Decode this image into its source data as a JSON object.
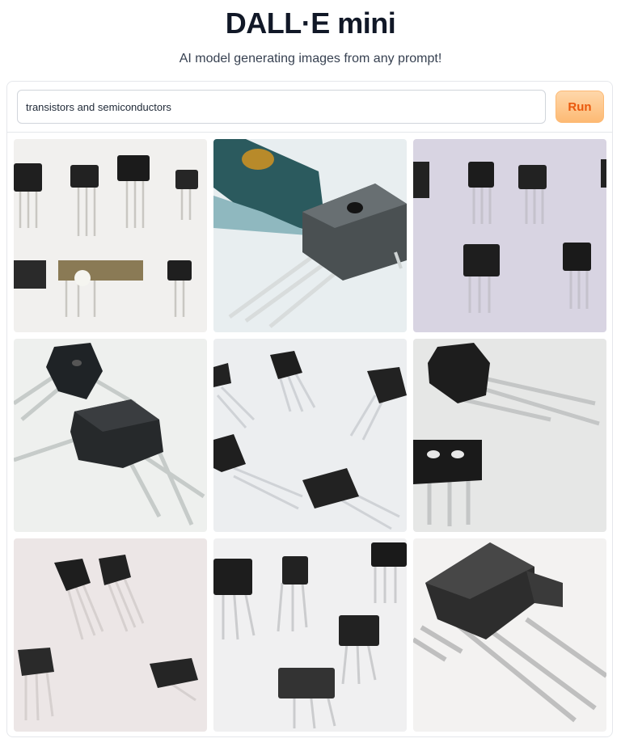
{
  "app": {
    "title": "DALL·E mini",
    "subtitle": "AI model generating images from any prompt!"
  },
  "prompt": {
    "value": "transistors and semiconductors"
  },
  "run_button": {
    "label": "Run"
  },
  "gallery": {
    "images": [
      {
        "subject": "transistors-row-white"
      },
      {
        "subject": "transistor-closeup-teal"
      },
      {
        "subject": "transistors-grid-lavender"
      },
      {
        "subject": "transistor-closeup-large"
      },
      {
        "subject": "transistors-scattered"
      },
      {
        "subject": "transistors-pair"
      },
      {
        "subject": "transistors-pink-background"
      },
      {
        "subject": "transistors-group"
      },
      {
        "subject": "transistor-closeup-dark"
      }
    ]
  },
  "colors": {
    "accent": "#ea580c",
    "button_bg": "#fed7aa",
    "border": "#e5e7eb"
  }
}
